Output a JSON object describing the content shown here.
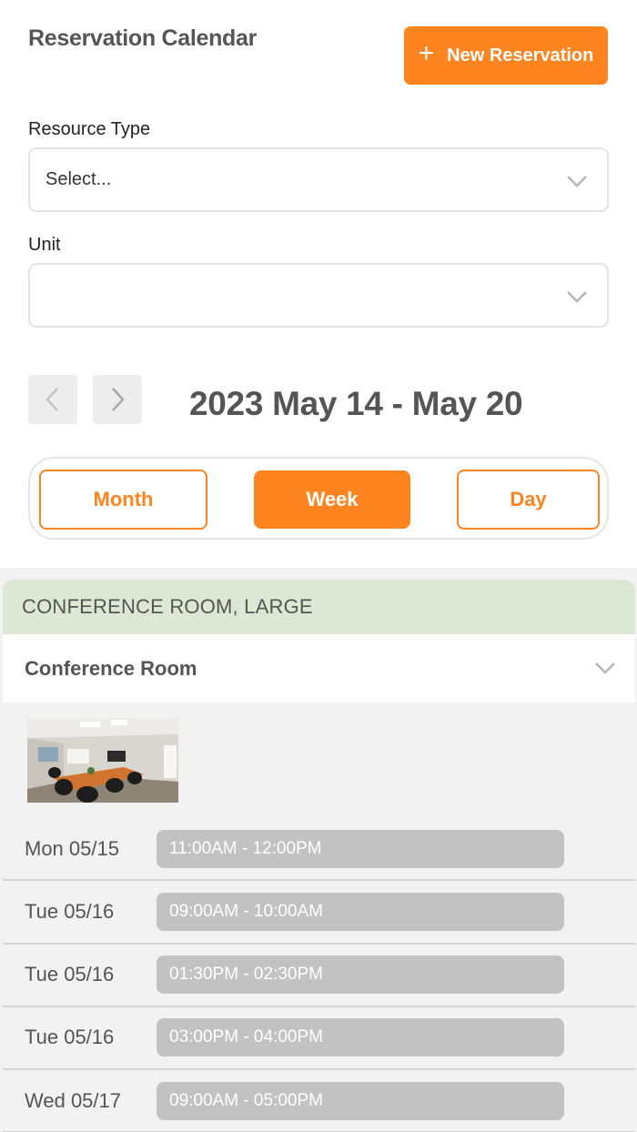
{
  "header": {
    "title": "Reservation Calendar",
    "new_button_label": "New Reservation"
  },
  "filters": {
    "resource_type": {
      "label": "Resource Type",
      "value": "Select..."
    },
    "unit": {
      "label": "Unit",
      "value": ""
    }
  },
  "date_nav": {
    "range": "2023 May 14 - May 20"
  },
  "view_toggle": {
    "options": [
      "Month",
      "Week",
      "Day"
    ],
    "selected": "Week"
  },
  "resource_group": {
    "title": "CONFERENCE ROOM, LARGE",
    "resource_name": "Conference Room",
    "reservations": [
      {
        "day": "Mon 05/15",
        "time": "11:00AM - 12:00PM"
      },
      {
        "day": "Tue 05/16",
        "time": "09:00AM - 10:00AM"
      },
      {
        "day": "Tue 05/16",
        "time": "01:30PM - 02:30PM"
      },
      {
        "day": "Tue 05/16",
        "time": "03:00PM - 04:00PM"
      },
      {
        "day": "Wed 05/17",
        "time": "09:00AM - 05:00PM"
      }
    ]
  },
  "colors": {
    "accent": "#fe8420",
    "group_header_bg": "#dde8d4",
    "slot_bg": "#c2c2c2",
    "panel_bg": "#f2f2f2"
  },
  "icons": {
    "plus": "plus-icon",
    "chevron_down": "chevron-down-icon",
    "chevron_left": "chevron-left-icon",
    "chevron_right": "chevron-right-icon"
  }
}
